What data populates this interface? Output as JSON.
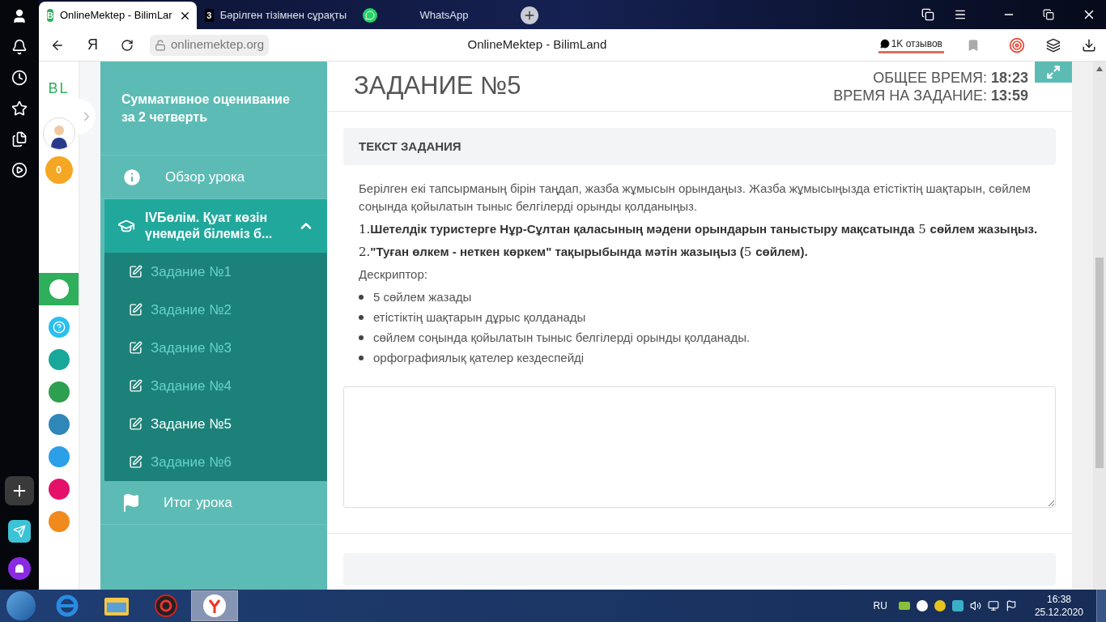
{
  "browser": {
    "tabs": [
      {
        "favicon": "B",
        "title": "OnlineMektep - BilimLar",
        "selected": true
      },
      {
        "favicon": "3",
        "title": "Бәрілген тізімнен сұрақты",
        "selected": false
      },
      {
        "title": "WhatsApp",
        "selected": false
      }
    ],
    "yandex_letter": "Я",
    "address": "onlinemektep.org",
    "page_title": "OnlineMektep - BilimLand",
    "reviews": "1K отзывов"
  },
  "site_rail": {
    "logo": "BL",
    "points": "0"
  },
  "sidebar": {
    "title": "Суммативное оценивание за 2 четверть",
    "items": [
      {
        "kind": "overview",
        "label": "Обзор урока"
      },
      {
        "kind": "section",
        "label": "IVБөлім. Қуат көзін үнемдей білеміз б...",
        "expanded": true,
        "children": [
          {
            "label": "Задание №1",
            "selected": false
          },
          {
            "label": "Задание №2",
            "selected": false
          },
          {
            "label": "Задание №3",
            "selected": false
          },
          {
            "label": "Задание №4",
            "selected": false
          },
          {
            "label": "Задание №5",
            "selected": true
          },
          {
            "label": "Задание №6",
            "selected": false
          }
        ]
      },
      {
        "kind": "summary",
        "label": "Итог урока"
      }
    ]
  },
  "task": {
    "title": "ЗАДАНИЕ №5",
    "total_time_label": "ОБЩЕЕ ВРЕМЯ:",
    "total_time": "18:23",
    "task_time_label": "ВРЕМЯ НА ЗАДАНИЕ:",
    "task_time": "13:59",
    "section_title": "ТЕКСТ ЗАДАНИЯ",
    "intro": "Берілген екі тапсырманың бірін таңдап, жазба жұмысын орындаңыз. Жазба жұмысыңызда етістіктің шақтарын, сөйлем соңында қойылатын тыныс белгілерді орынды қолданыңыз.",
    "options": [
      "1.**Шетелдік туристерге Нұр-Сұлтан қаласының мәдени орындарын таныстыру мақсатында** 5 **сөйлем жазыңыз.**",
      "2.**\"Туған өлкем - неткен көркем\" тақырыбында мәтін жазыңыз (**5 **сөйлем).**"
    ],
    "descriptor_label": "Дескриптор:",
    "descriptors": [
      "5 сөйлем жазады",
      "етістіктің шақтарын дұрыс қолданады",
      "сөйлем соңында қойылатын тыныс белгілерді орынды қолданады.",
      "орфографиялық қателер кездеспейді"
    ]
  },
  "taskbar": {
    "language": "RU",
    "time": "16:38",
    "date": "25.12.2020"
  }
}
